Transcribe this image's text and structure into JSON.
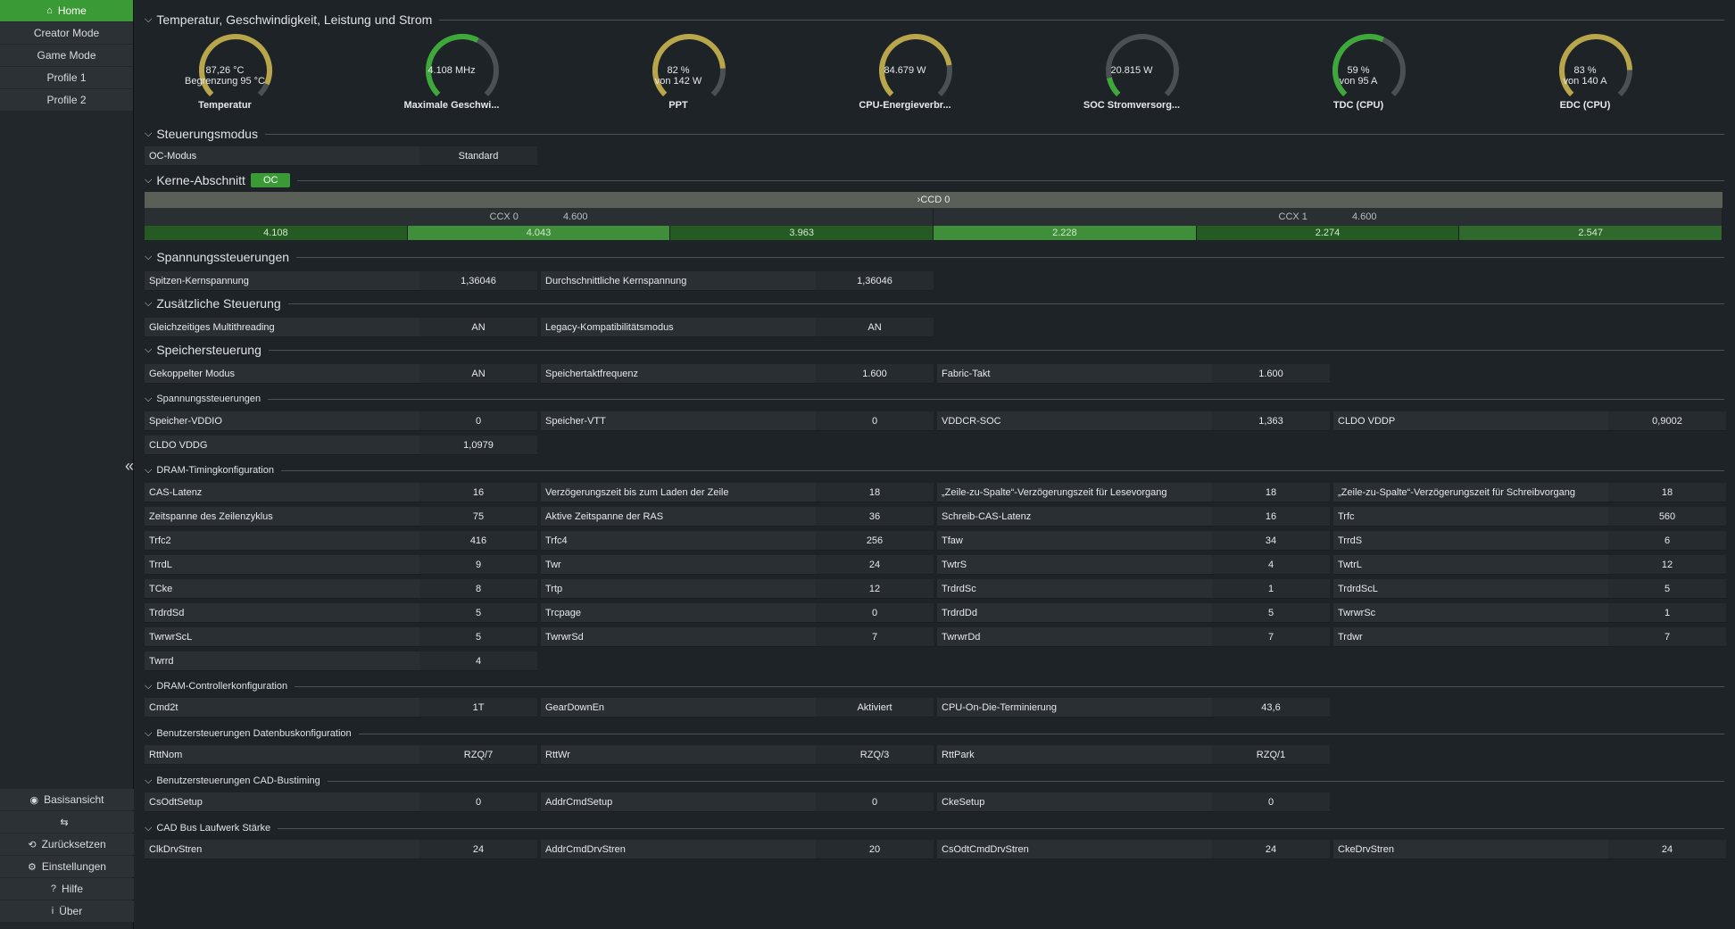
{
  "sidebar": {
    "items": [
      {
        "label": "Home",
        "active": true
      },
      {
        "label": "Creator Mode"
      },
      {
        "label": "Game Mode"
      },
      {
        "label": "Profile 1"
      },
      {
        "label": "Profile 2"
      }
    ],
    "bottom": [
      {
        "label": "Basisansicht",
        "icon": "eye-icon"
      },
      {
        "label": "",
        "icon": "compare-icon"
      },
      {
        "label": "Zurücksetzen",
        "icon": "reset-icon"
      },
      {
        "label": "Einstellungen",
        "icon": "gear-icon"
      },
      {
        "label": "Hilfe",
        "icon": "help-icon"
      },
      {
        "label": "Über",
        "icon": "info-icon"
      }
    ]
  },
  "sections": {
    "temp": "Temperatur, Geschwindigkeit, Leistung und Strom",
    "steuer": "Steuerungsmodus",
    "kerne": "Kerne-Abschnitt",
    "kerne_badge": "OC",
    "spannung": "Spannungssteuerungen",
    "zusatz": "Zusätzliche Steuerung",
    "speicher": "Speichersteuerung",
    "spannung2": "Spannungssteuerungen",
    "dram": "DRAM-Timingkonfiguration",
    "dramctl": "DRAM-Controllerkonfiguration",
    "datenbus": "Benutzersteuerungen Datenbuskonfiguration",
    "cad": "Benutzersteuerungen CAD-Bustiming",
    "cadbus": "CAD Bus Laufwerk Stärke"
  },
  "gauges": [
    {
      "value": "87,26 °C",
      "sub": "Begrenzung 95 °C",
      "name": "Temperatur",
      "fill": 0.92,
      "color": "#b9a64a"
    },
    {
      "value": "4.108  MHz",
      "sub": "",
      "name": "Maximale Geschwi...",
      "fill": 0.6,
      "color": "#3fa83a"
    },
    {
      "value": "82 %",
      "sub": "von 142 W",
      "name": "PPT",
      "fill": 0.82,
      "color": "#b9a64a"
    },
    {
      "value": "84.679 W",
      "sub": "",
      "name": "CPU-Energieverbr...",
      "fill": 0.8,
      "color": "#b9a64a"
    },
    {
      "value": "20.815 W",
      "sub": "",
      "name": "SOC Stromversorg...",
      "fill": 0.12,
      "color": "#3fa83a"
    },
    {
      "value": "59 %",
      "sub": "von 95 A",
      "name": "TDC (CPU)",
      "fill": 0.59,
      "color": "#3fa83a"
    },
    {
      "value": "83 %",
      "sub": "von 140 A",
      "name": "EDC (CPU)",
      "fill": 0.83,
      "color": "#b9a64a"
    }
  ],
  "oc": {
    "label": "OC-Modus",
    "value": "Standard"
  },
  "ccd": {
    "label": "CCD 0",
    "ccx": [
      {
        "label": "CCX 0",
        "freq": "4.600"
      },
      {
        "label": "CCX 1",
        "freq": "4.600"
      }
    ],
    "cores": [
      "4.108",
      "4.043",
      "3.963",
      "2.228",
      "2.274",
      "2.547"
    ]
  },
  "rows": {
    "spannung": [
      [
        "Spitzen-Kernspannung",
        "1,36046"
      ],
      [
        "Durchschnittliche Kernspannung",
        "1,36046"
      ]
    ],
    "zusatz": [
      [
        "Gleichzeitiges Multithreading",
        "AN"
      ],
      [
        "Legacy-Kompatibilitätsmodus",
        "AN"
      ]
    ],
    "speicher": [
      [
        "Gekoppelter Modus",
        "AN"
      ],
      [
        "Speichertaktfrequenz",
        "1.600"
      ],
      [
        "Fabric-Takt",
        "1.600"
      ]
    ],
    "volt1": [
      [
        "Speicher-VDDIO",
        "0"
      ],
      [
        "Speicher-VTT",
        "0"
      ],
      [
        "VDDCR-SOC",
        "1,363"
      ],
      [
        "CLDO VDDP",
        "0,9002"
      ]
    ],
    "volt2": [
      [
        "CLDO VDDG",
        "1,0979"
      ]
    ],
    "dram": [
      [
        [
          "CAS-Latenz",
          "16"
        ],
        [
          "Verzögerungszeit bis zum Laden der Zeile",
          "18"
        ],
        [
          "„Zeile-zu-Spalte“-Verzögerungszeit für Lesevorgang",
          "18"
        ],
        [
          "„Zeile-zu-Spalte“-Verzögerungszeit für Schreibvorgang",
          "18"
        ]
      ],
      [
        [
          "Zeitspanne des Zeilenzyklus",
          "75"
        ],
        [
          "Aktive Zeitspanne der RAS",
          "36"
        ],
        [
          "Schreib-CAS-Latenz",
          "16"
        ],
        [
          "Trfc",
          "560"
        ]
      ],
      [
        [
          "Trfc2",
          "416"
        ],
        [
          "Trfc4",
          "256"
        ],
        [
          "Tfaw",
          "34"
        ],
        [
          "TrrdS",
          "6"
        ]
      ],
      [
        [
          "TrrdL",
          "9"
        ],
        [
          "Twr",
          "24"
        ],
        [
          "TwtrS",
          "4"
        ],
        [
          "TwtrL",
          "12"
        ]
      ],
      [
        [
          "TCke",
          "8"
        ],
        [
          "Trtp",
          "12"
        ],
        [
          "TrdrdSc",
          "1"
        ],
        [
          "TrdrdScL",
          "5"
        ]
      ],
      [
        [
          "TrdrdSd",
          "5"
        ],
        [
          "Trcpage",
          "0"
        ],
        [
          "TrdrdDd",
          "5"
        ],
        [
          "TwrwrSc",
          "1"
        ]
      ],
      [
        [
          "TwrwrScL",
          "5"
        ],
        [
          "TwrwrSd",
          "7"
        ],
        [
          "TwrwrDd",
          "7"
        ],
        [
          "Trdwr",
          "7"
        ]
      ],
      [
        [
          "Twrrd",
          "4"
        ]
      ]
    ],
    "dramctl": [
      [
        "Cmd2t",
        "1T"
      ],
      [
        "GearDownEn",
        "Aktiviert"
      ],
      [
        "CPU-On-Die-Terminierung",
        "43,6"
      ]
    ],
    "datenbus": [
      [
        "RttNom",
        "RZQ/7"
      ],
      [
        "RttWr",
        "RZQ/3"
      ],
      [
        "RttPark",
        "RZQ/1"
      ]
    ],
    "cad": [
      [
        "CsOdtSetup",
        "0"
      ],
      [
        "AddrCmdSetup",
        "0"
      ],
      [
        "CkeSetup",
        "0"
      ]
    ],
    "cadbus": [
      [
        "ClkDrvStren",
        "24"
      ],
      [
        "AddrCmdDrvStren",
        "20"
      ],
      [
        "CsOdtCmdDrvStren",
        "24"
      ],
      [
        "CkeDrvStren",
        "24"
      ]
    ]
  }
}
